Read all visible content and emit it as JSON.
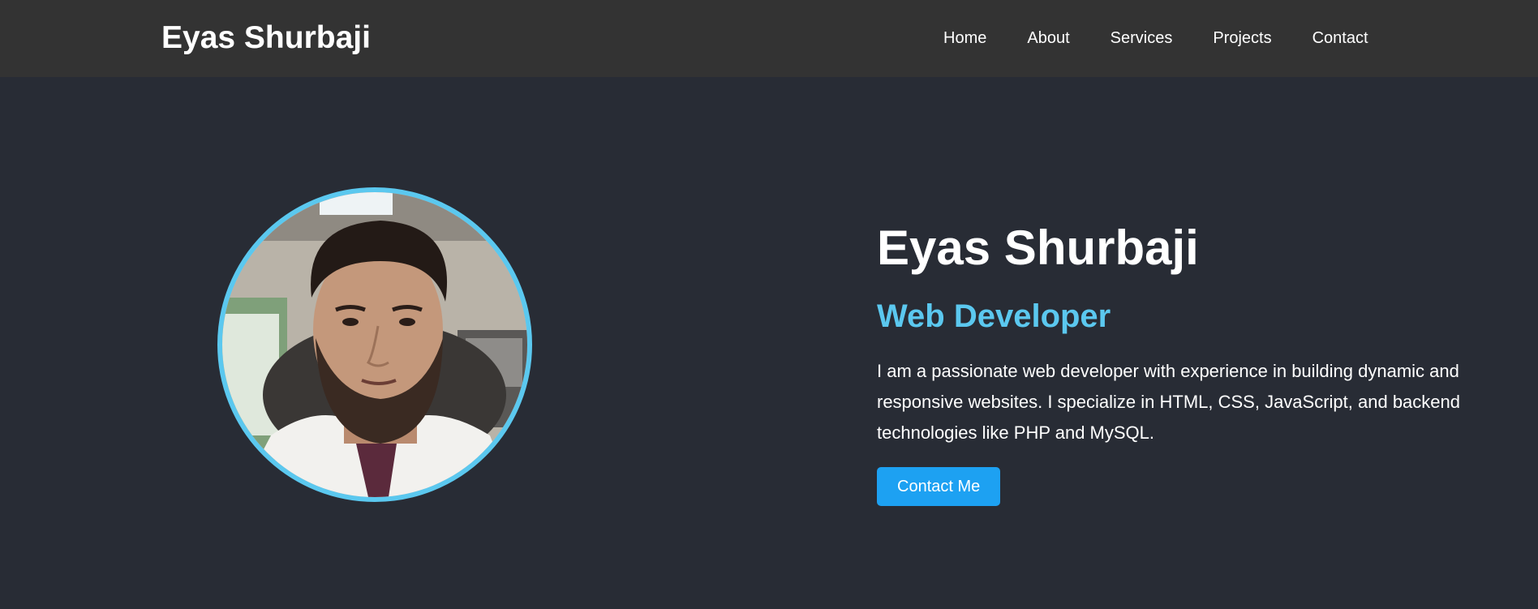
{
  "header": {
    "brand": "Eyas Shurbaji",
    "nav": [
      {
        "label": "Home"
      },
      {
        "label": "About"
      },
      {
        "label": "Services"
      },
      {
        "label": "Projects"
      },
      {
        "label": "Contact"
      }
    ]
  },
  "hero": {
    "name": "Eyas Shurbaji",
    "role": "Web Developer",
    "bio": "I am a passionate web developer with experience in building dynamic and responsive websites. I specialize in HTML, CSS, JavaScript, and backend technologies like PHP and MySQL.",
    "cta_label": "Contact Me",
    "avatar_alt": "profile-photo"
  },
  "colors": {
    "navbar_bg": "#333333",
    "page_bg": "#282c35",
    "accent": "#5bc8ef",
    "button_bg": "#1da1f2",
    "text": "#ffffff"
  }
}
